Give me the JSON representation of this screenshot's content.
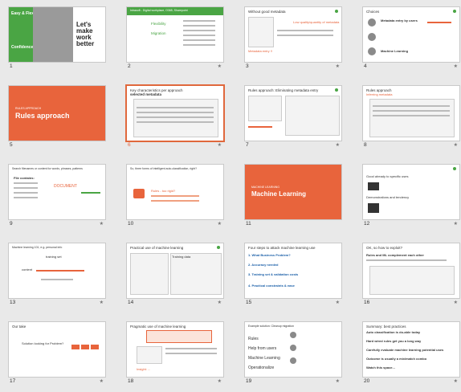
{
  "slides": [
    {
      "n": "1",
      "t1": "Easy & Flexible",
      "t2": "Let's make work better",
      "t3": "Confidence & Control"
    },
    {
      "n": "2",
      "t1": "Intrasoft - Digital workplace, O365, Sharepoint",
      "t2": "Flexibility",
      "t3": "Migration"
    },
    {
      "n": "3",
      "t1": "Without good metadata",
      "t2": "Metadata entry !!",
      "t3": "Low quality/quantity of metadata"
    },
    {
      "n": "4",
      "t1": "Choices",
      "t2": "Metadata entry by users",
      "t3": "Machine Learning"
    },
    {
      "n": "5",
      "t1": "RULES APPROACH",
      "t2": "Rules approach"
    },
    {
      "n": "6",
      "t1": "Key characteristics per approach",
      "t2": "selected metadata"
    },
    {
      "n": "7",
      "t1": "Rules approach: Eliminating metadata entry"
    },
    {
      "n": "8",
      "t1": "Rules approach",
      "t2": "Inferring metadata"
    },
    {
      "n": "9",
      "t1": "Search filenames or content for words, phrases, patterns",
      "t2": "File contains:",
      "t3": "DOCUMENT"
    },
    {
      "n": "10",
      "t1": "So, three forms of intelligent auto-classification, right?",
      "t2": "Rules - too rigid?"
    },
    {
      "n": "11",
      "t1": "MACHINE LEARNING",
      "t2": "Machine Learning"
    },
    {
      "n": "12",
      "t1": "Good already to specific uses",
      "t2": "Demonstrations and tendency"
    },
    {
      "n": "13",
      "t1": "Machine learning 101, e.g. personal info",
      "t2": "training set",
      "t3": "content"
    },
    {
      "n": "14",
      "t1": "Practical use of machine learning",
      "t2": "Training data"
    },
    {
      "n": "15",
      "t1": "Four steps to attack machine learning use",
      "t2": "1. What Business Problem?",
      "t3": "2. Accuracy needed",
      "t4": "3. Training set & validation costs",
      "t5": "4. Practical constraints & ease"
    },
    {
      "n": "16",
      "t1": "OK, so how to exploit?",
      "t2": "Rules and ML complement each other"
    },
    {
      "n": "17",
      "t1": "Our take",
      "t2": "Solution looking for Problem?"
    },
    {
      "n": "18",
      "t1": "Pragmatic use of machine learning",
      "t2": "Insight: ..."
    },
    {
      "n": "19",
      "t1": "Example solution: Cleanup migration",
      "t2": "Rules",
      "t3": "Help from users",
      "t4": "Machine Learning",
      "t5": "Operationalize"
    },
    {
      "n": "20",
      "t1": "Summary: best practices",
      "t2": "Auto classification is do-able today",
      "t3": "Hard wired rules get you a long way",
      "t4": "Carefully evaluate machine learning potential uses",
      "t5": "Outcome is usually a mix/match combo",
      "t6": "Watch this space..."
    }
  ],
  "colors": {
    "accent": "#e8643c",
    "brand": "#4aa544"
  }
}
